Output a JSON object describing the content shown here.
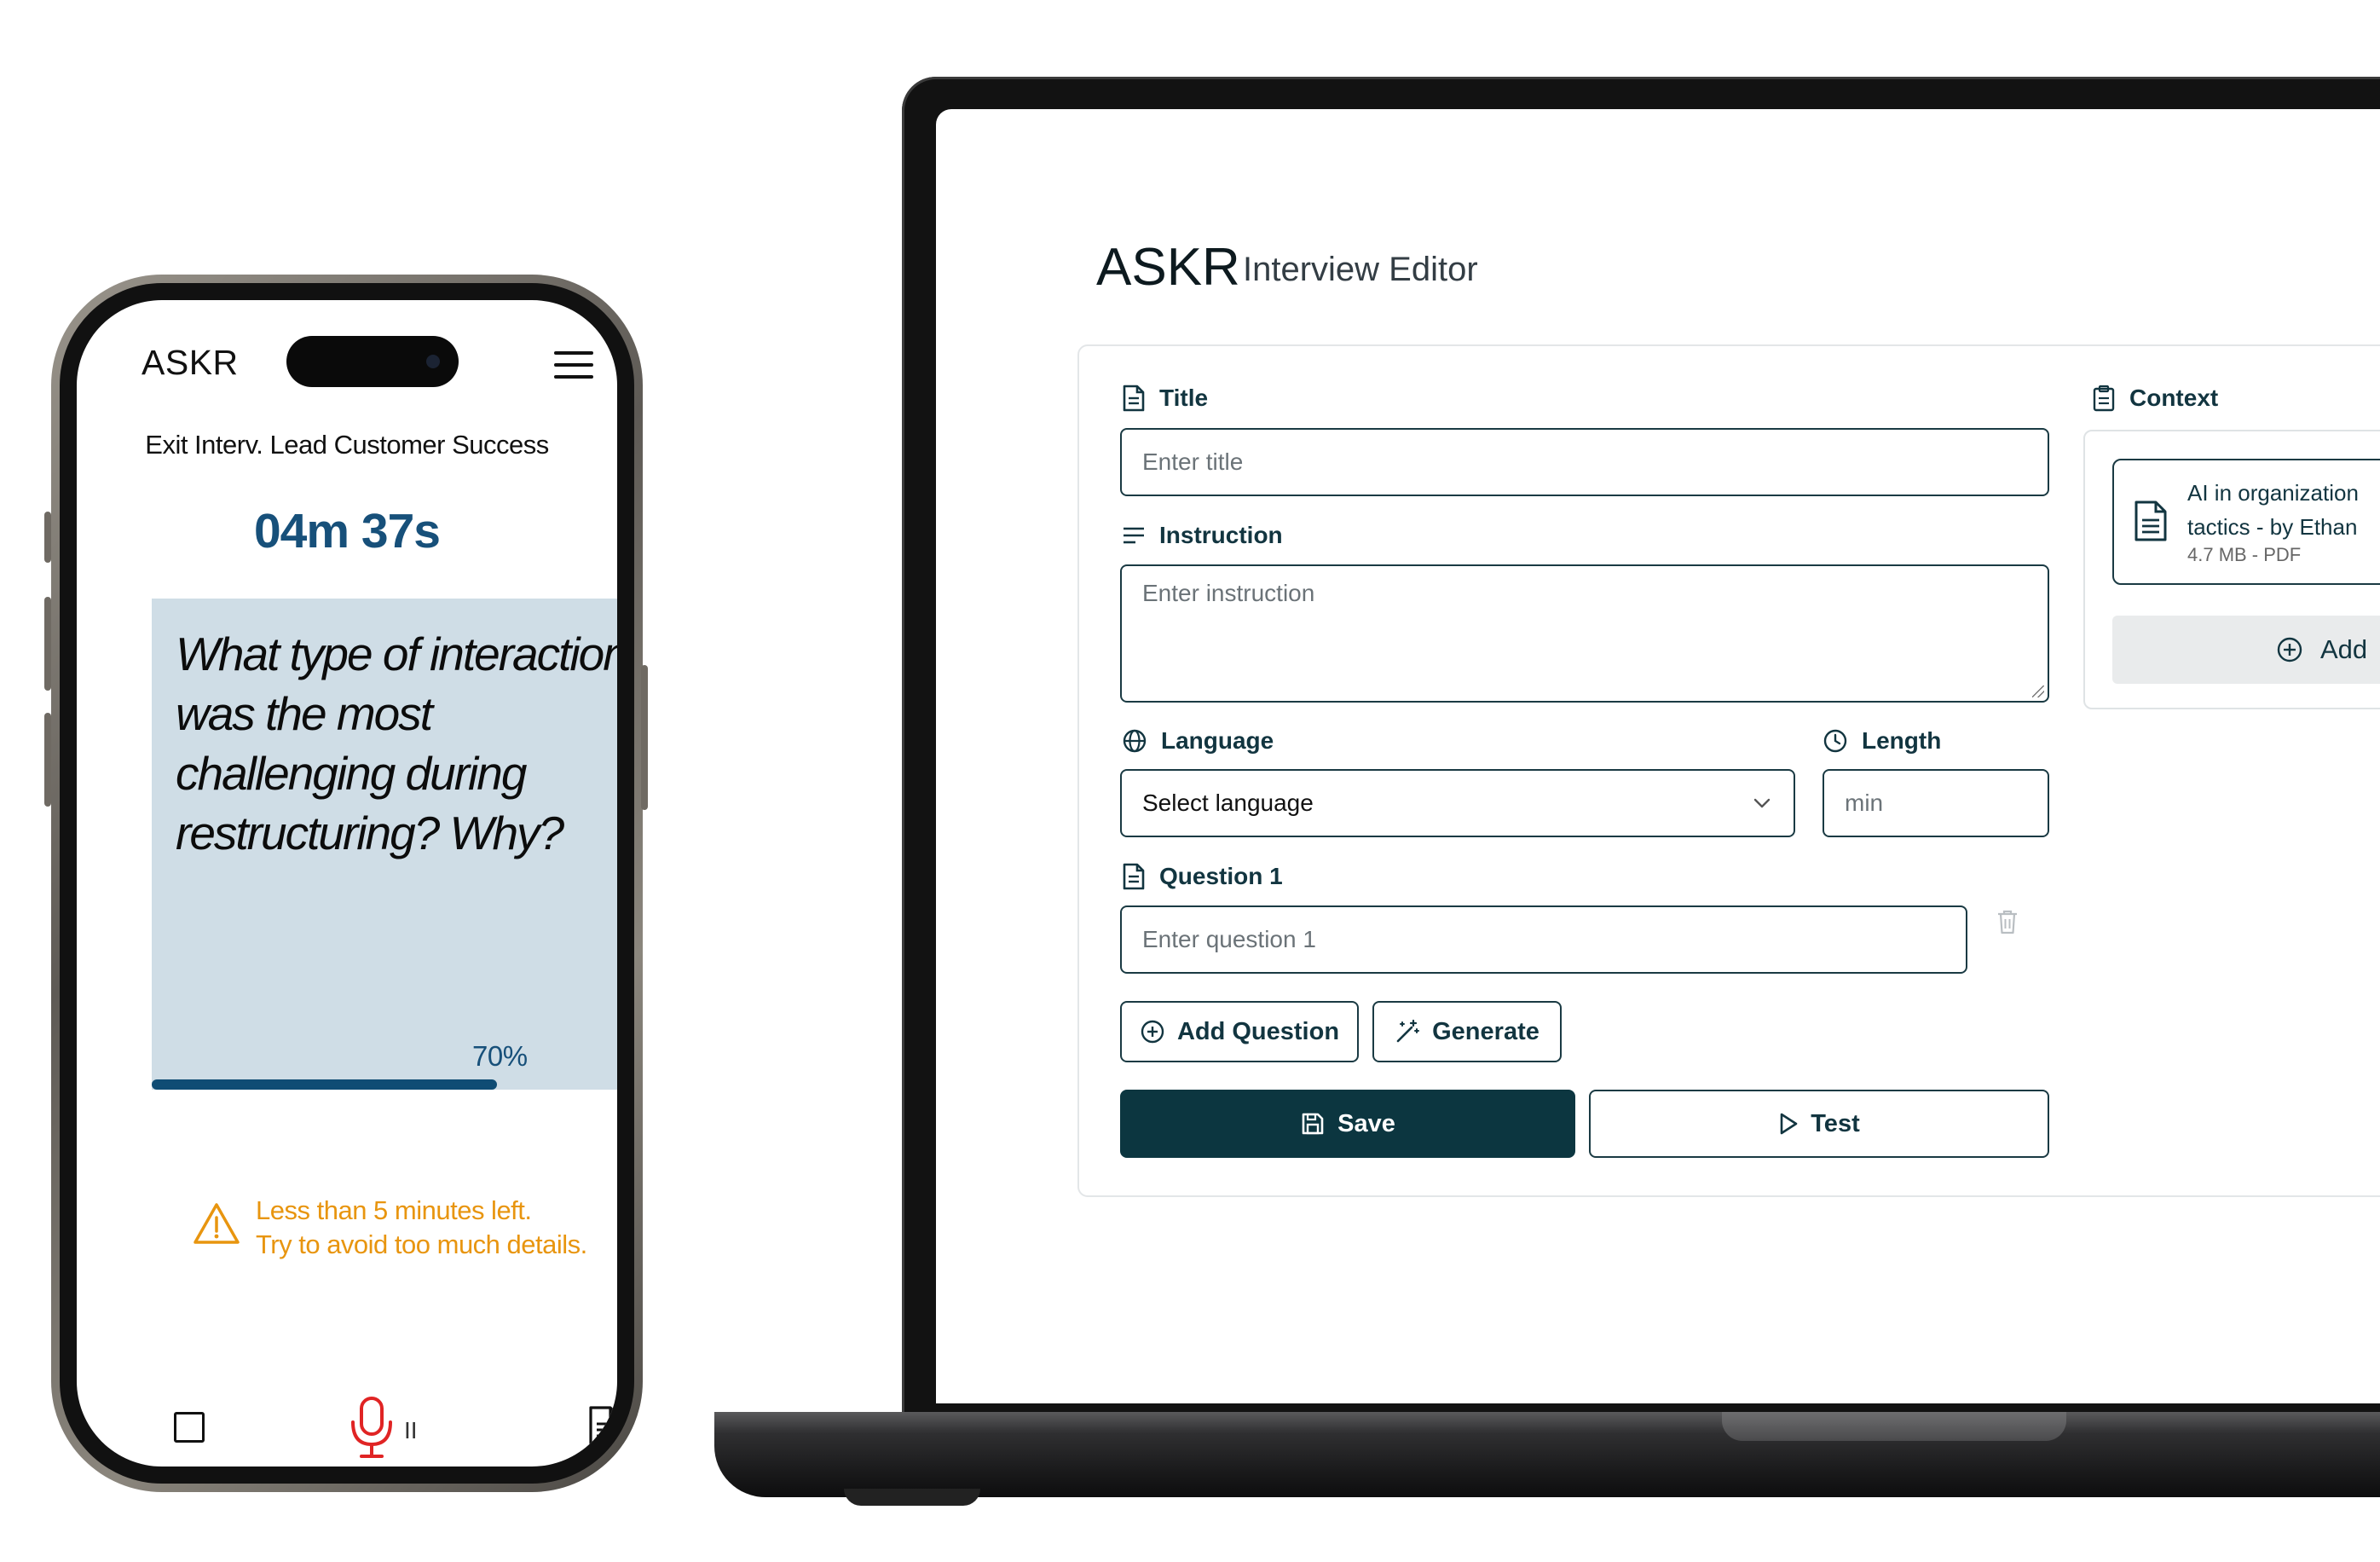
{
  "phone": {
    "logo": "ASKR",
    "interview_title": "Exit Interv. Lead Customer Success",
    "timer": "04m 37s",
    "question": "What type of interaction was the most challenging during restructuring? Why?",
    "progress_label": "70%",
    "progress": 0.7,
    "warning_line1": "Less than 5 minutes left.",
    "warning_line2": "Try to avoid too much details.",
    "pause_glyph": "II",
    "colors": {
      "timer": "#17507a",
      "card": "#cfdde6",
      "warning": "#e8950f",
      "mic": "#e02424"
    },
    "icons": [
      "menu-icon",
      "warning-icon",
      "stop-icon",
      "microphone-icon",
      "document-icon"
    ]
  },
  "editor": {
    "logo": "ASKR",
    "page_title": "Interview Editor",
    "title_label": "Title",
    "title_placeholder": "Enter title",
    "instruction_label": "Instruction",
    "instruction_placeholder": "Enter instruction",
    "language_label": "Language",
    "language_value": "Select language",
    "length_label": "Length",
    "length_placeholder": "min",
    "question_label": "Question 1",
    "question_placeholder": "Enter question 1",
    "add_question": "Add Question",
    "generate": "Generate",
    "save": "Save",
    "test": "Test",
    "context_label": "Context",
    "context_file": {
      "name_line1": "AI in organization",
      "name_line2": "tactics - by Ethan",
      "meta": "4.7 MB - PDF"
    },
    "context_add": "Add",
    "colors": {
      "primary": "#0c3640",
      "border": "#1a3a43",
      "text": "#123540"
    }
  }
}
